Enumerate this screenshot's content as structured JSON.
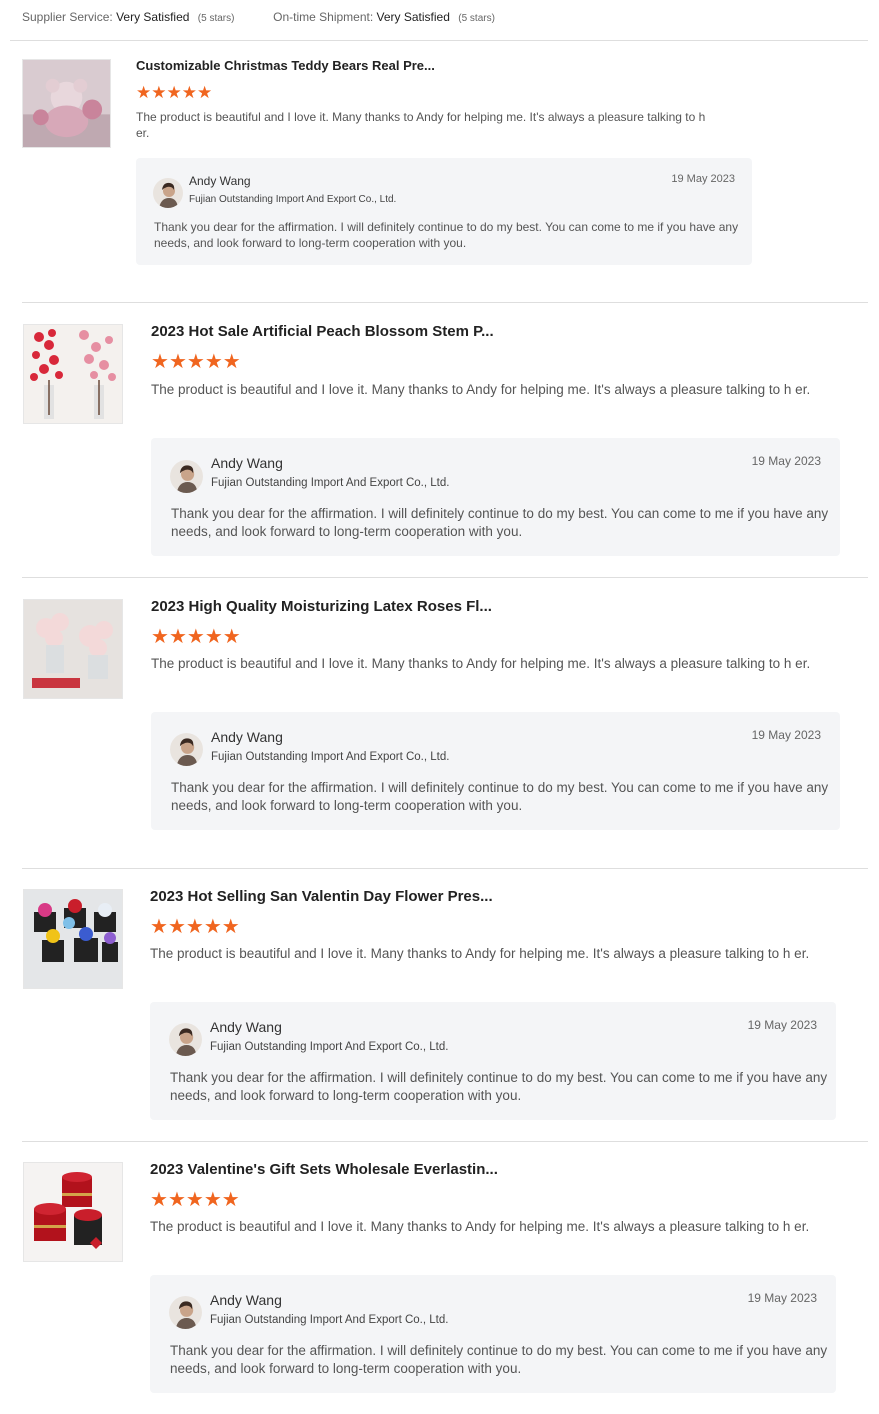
{
  "summary": {
    "supplier_label": "Supplier Service:",
    "supplier_value": "Very Satisfied",
    "supplier_note": "(5 stars)",
    "shipment_label": "On-time Shipment:",
    "shipment_value": "Very Satisfied",
    "shipment_note": "(5 stars)"
  },
  "colors": {
    "star": "#f0651f",
    "reply_bg": "#f4f5f7",
    "divider": "#dedede"
  },
  "reviews": [
    {
      "product_title": "Customizable Christmas Teddy Bears Real Pre...",
      "rating": 5,
      "comment": "The product is beautiful and I love it. Many thanks to Andy for helping me. It's always a pleasure talking to h er.",
      "thumb_icon": "teddy-bear-product-image",
      "reply": {
        "name": "Andy Wang",
        "company": "Fujian Outstanding Import And Export Co., Ltd.",
        "date": "19 May 2023",
        "text": "Thank you dear for the affirmation. I will definitely continue to do my best. You can come to me if you have any needs, and look forward to long-term cooperation with you."
      }
    },
    {
      "product_title": "2023 Hot Sale Artificial Peach Blossom Stem P...",
      "rating": 5,
      "comment": "The product is beautiful and I love it. Many thanks to Andy for helping me. It's always a pleasure talking to h er.",
      "thumb_icon": "peach-blossom-product-image",
      "reply": {
        "name": "Andy Wang",
        "company": "Fujian Outstanding Import And Export Co., Ltd.",
        "date": "19 May 2023",
        "text": "Thank you dear for the affirmation. I will definitely continue to do my best. You can come to me if you have any needs, and look forward to long-term cooperation with you."
      }
    },
    {
      "product_title": "2023 High Quality Moisturizing Latex Roses Fl...",
      "rating": 5,
      "comment": "The product is beautiful and I love it. Many thanks to Andy for helping me. It's always a pleasure talking to h er.",
      "thumb_icon": "latex-roses-product-image",
      "reply": {
        "name": "Andy Wang",
        "company": "Fujian Outstanding Import And Export Co., Ltd.",
        "date": "19 May 2023",
        "text": "Thank you dear for the affirmation. I will definitely continue to do my best. You can come to me if you have any needs, and look forward to long-term cooperation with you."
      }
    },
    {
      "product_title": "2023 Hot Selling San Valentin Day Flower Pres...",
      "rating": 5,
      "comment": "The product is beautiful and I love it. Many thanks to Andy for helping me. It's always a pleasure talking to h er.",
      "thumb_icon": "rose-gift-boxes-product-image",
      "reply": {
        "name": "Andy Wang",
        "company": "Fujian Outstanding Import And Export Co., Ltd.",
        "date": "19 May 2023",
        "text": "Thank you dear for the affirmation. I will definitely continue to do my best. You can come to me if you have any needs, and look forward to long-term cooperation with you."
      }
    },
    {
      "product_title": "2023 Valentine's Gift Sets Wholesale Everlastin...",
      "rating": 5,
      "comment": "The product is beautiful and I love it. Many thanks to Andy for helping me. It's always a pleasure talking to h er.",
      "thumb_icon": "rose-hat-boxes-product-image",
      "reply": {
        "name": "Andy Wang",
        "company": "Fujian Outstanding Import And Export Co., Ltd.",
        "date": "19 May 2023",
        "text": "Thank you dear for the affirmation. I will definitely continue to do my best. You can come to me if you have any needs, and look forward to long-term cooperation with you."
      }
    }
  ]
}
